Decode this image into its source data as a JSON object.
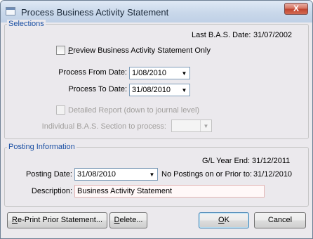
{
  "window": {
    "title": "Process Business Activity Statement",
    "close_glyph": "X",
    "app_icon": "document-window-icon"
  },
  "selections": {
    "title": "Selections",
    "last_bas_label": "Last B.A.S. Date:",
    "last_bas_value": "31/07/2002",
    "preview": {
      "label_first": "P",
      "label_rest": "review Business Activity Statement Only",
      "checked": false
    },
    "process_from": {
      "label": "Process From Date:",
      "value": "1/08/2010"
    },
    "process_to": {
      "label": "Process To Date:",
      "value": "31/08/2010"
    },
    "detailed_report": {
      "label": "Detailed Report (down to journal level)",
      "checked": false,
      "enabled": false
    },
    "individual_section": {
      "label": "Individual B.A.S. Section to process:",
      "value": "",
      "enabled": false
    }
  },
  "posting": {
    "title": "Posting Information",
    "gl_year_end_label": "G/L Year End:",
    "gl_year_end_value": "31/12/2011",
    "posting_date": {
      "label": "Posting Date:",
      "value": "31/08/2010"
    },
    "no_postings_label": "No Postings on or Prior to:",
    "no_postings_value": "31/12/2010",
    "description": {
      "label": "Description:",
      "value": "Business Activity Statement"
    }
  },
  "buttons": {
    "reprint": {
      "first": "R",
      "rest": "e-Print Prior Statement..."
    },
    "delete": {
      "first": "D",
      "rest": "elete..."
    },
    "ok": {
      "first": "O",
      "rest": "K"
    },
    "cancel": "Cancel"
  },
  "colors": {
    "group_title": "#1a4fa3",
    "window_bg": "#ebe9ed",
    "disabled_text": "#a19f9d"
  }
}
